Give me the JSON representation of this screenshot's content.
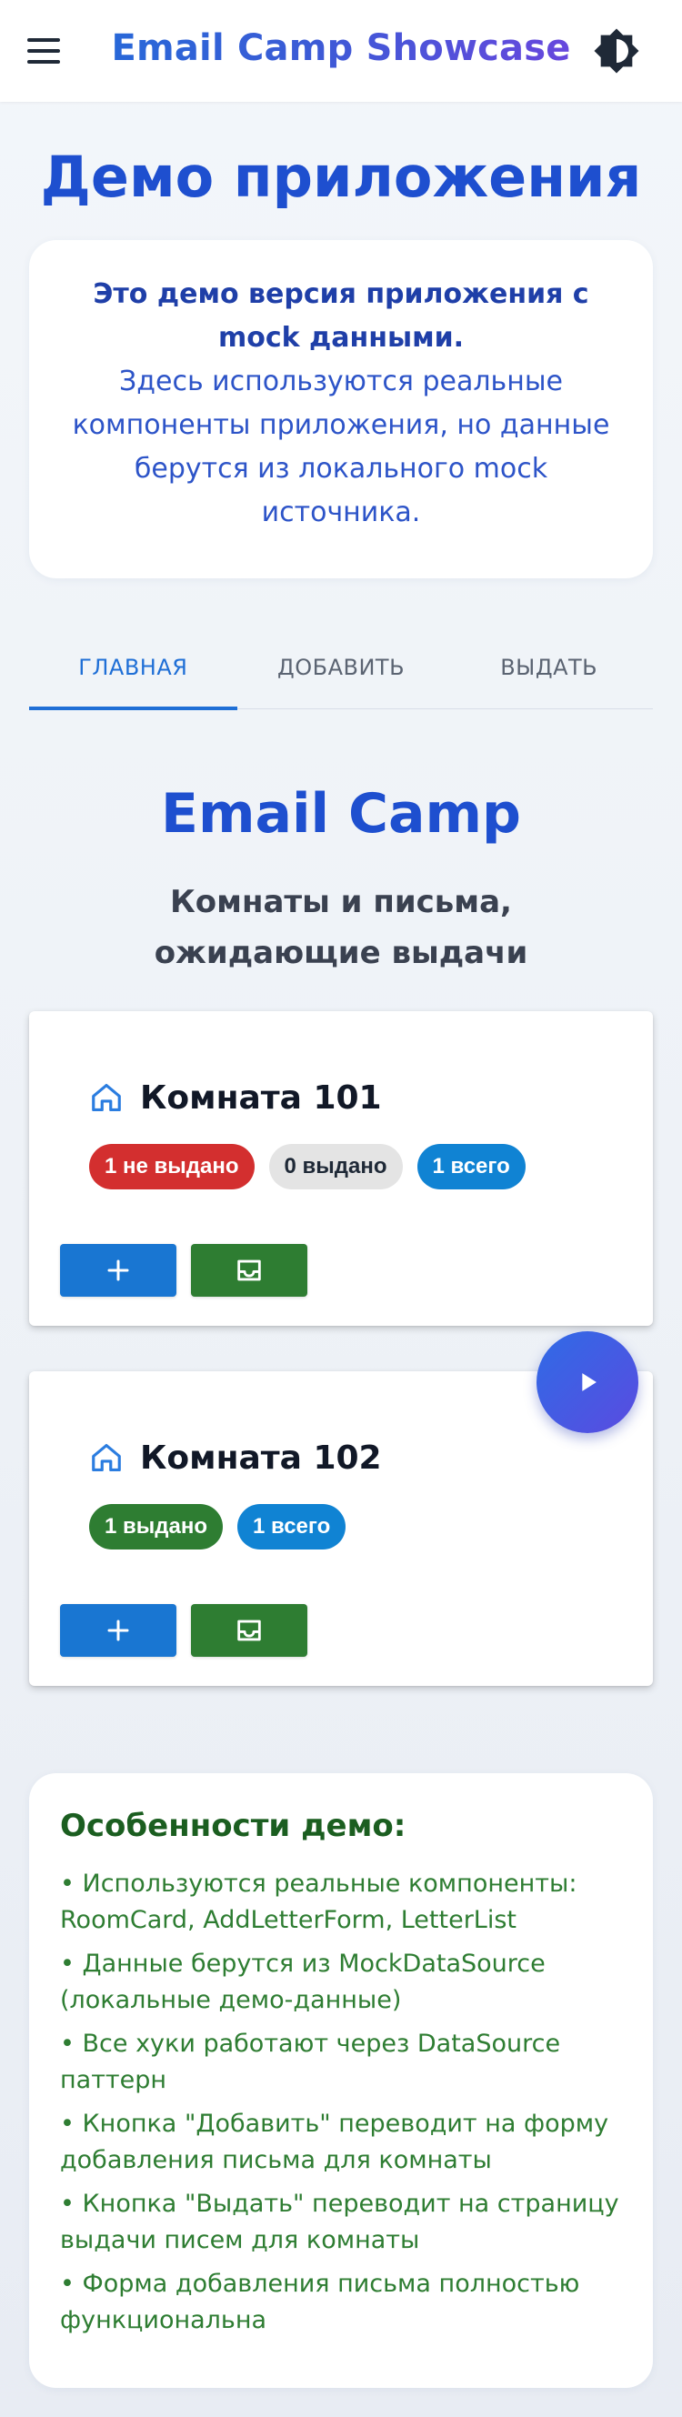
{
  "appbar": {
    "title": "Email Camp Showcase",
    "menu_icon": "menu-icon",
    "theme_icon": "brightness-icon"
  },
  "page_title": "Демо приложения",
  "info": {
    "strong": "Это демо версия приложения с mock данными.",
    "body": "Здесь используются реальные компоненты приложения, но данные берутся из локального mock источника."
  },
  "tabs": [
    {
      "label": "ГЛАВНАЯ",
      "active": true
    },
    {
      "label": "ДОБАВИТЬ",
      "active": false
    },
    {
      "label": "ВЫДАТЬ",
      "active": false
    }
  ],
  "brand": "Email Camp",
  "subtitle": "Комнаты и письма, ожидающие выдачи",
  "rooms": [
    {
      "name": "Комната 101",
      "chips": [
        {
          "label": "1 не выдано",
          "color": "#d32f2f"
        },
        {
          "label": "0 выдано",
          "color": "#e4e4e4"
        },
        {
          "label": "1 всего",
          "color": "#1083d3"
        }
      ]
    },
    {
      "name": "Комната 102",
      "chips": [
        {
          "label": "1 выдано",
          "color": "#2e7d32"
        },
        {
          "label": "1 всего",
          "color": "#1083d3"
        }
      ]
    }
  ],
  "features": {
    "title": "Особенности демо:",
    "items": [
      "• Используются реальные компоненты: RoomCard, AddLetterForm, LetterList",
      "• Данные берутся из MockDataSource (локальные демо-данные)",
      "• Все хуки работают через DataSource паттерн",
      "• Кнопка \"Добавить\" переводит на форму добавления письма для комнаты",
      "• Кнопка \"Выдать\" переводит на страницу выдачи писем для комнаты",
      "• Форма добавления письма полностью функциональна"
    ]
  },
  "colors": {
    "primary": "#1e4fcf",
    "tab_active": "#1f6fd6",
    "add_button": "#1976d2",
    "issue_button": "#2e7d32",
    "features_text": "#2e7d32"
  }
}
